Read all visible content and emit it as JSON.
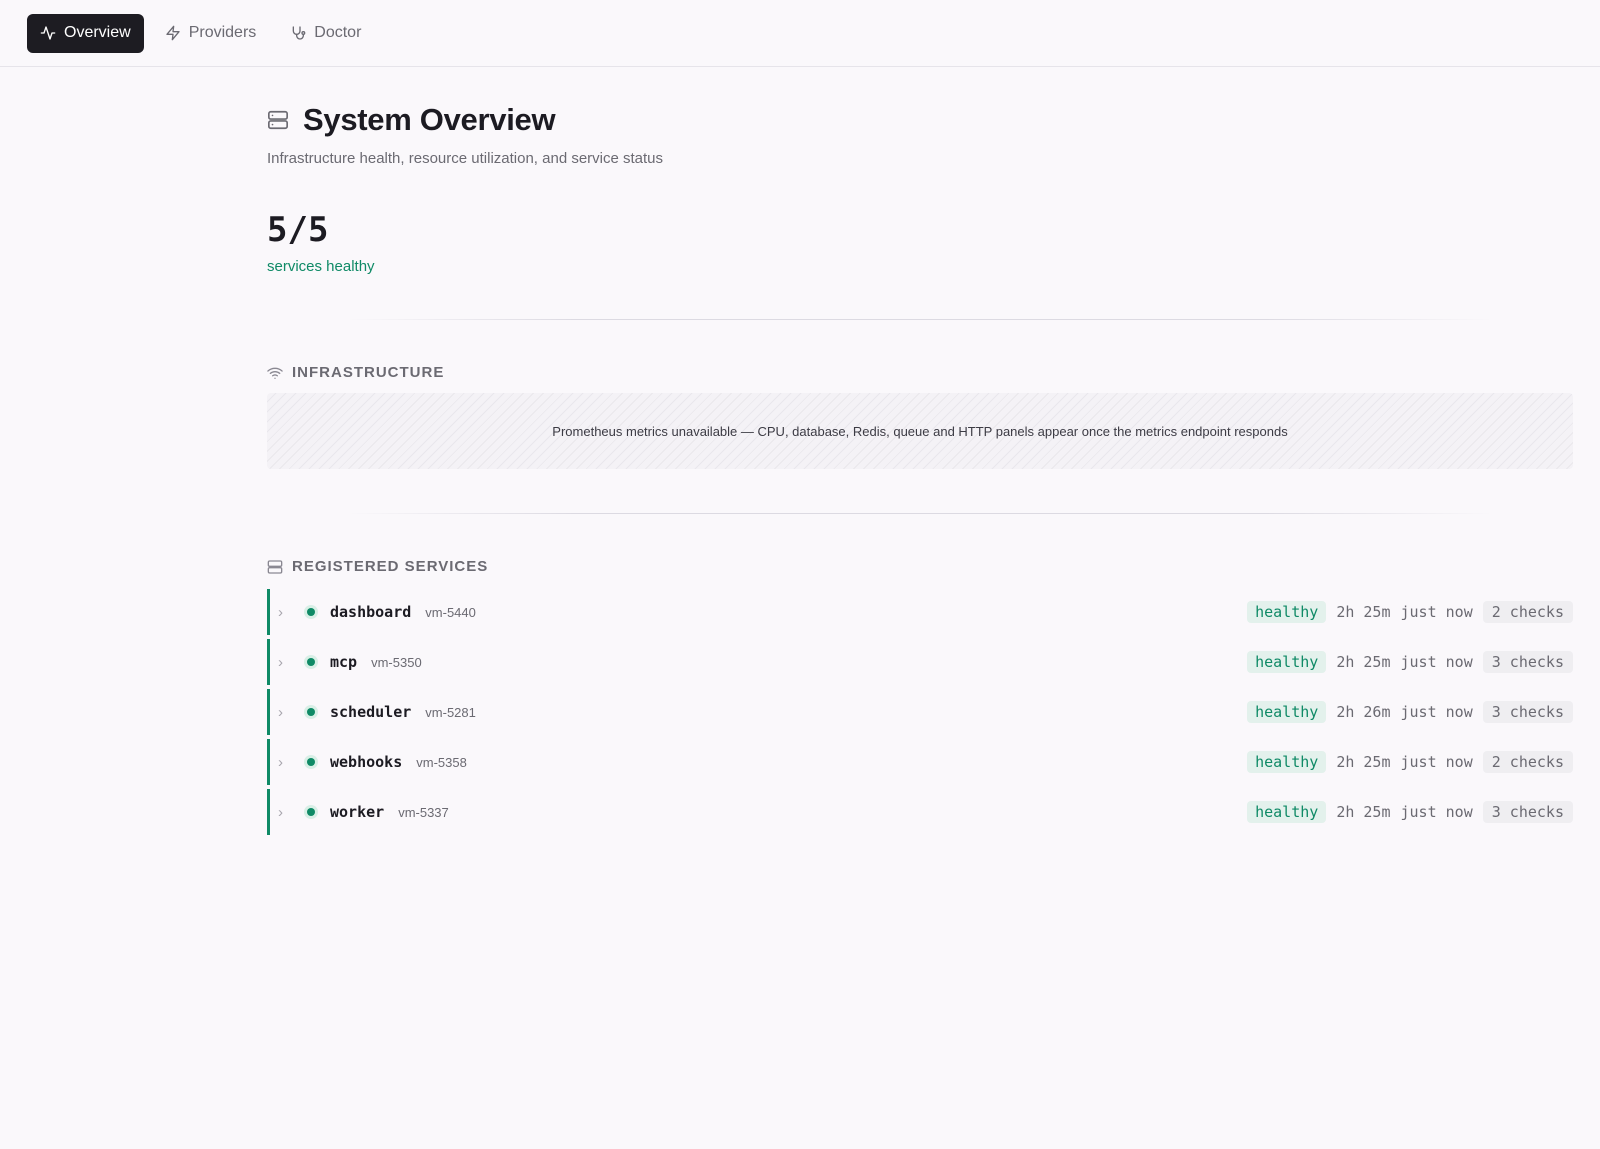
{
  "nav": {
    "tabs": [
      {
        "label": "Overview",
        "icon": "activity-icon",
        "active": true
      },
      {
        "label": "Providers",
        "icon": "zap-icon",
        "active": false
      },
      {
        "label": "Doctor",
        "icon": "stethoscope-icon",
        "active": false
      }
    ]
  },
  "header": {
    "title": "System Overview",
    "subtitle": "Infrastructure health, resource utilization, and service status"
  },
  "summary": {
    "count": "5/5",
    "label": "services healthy"
  },
  "infrastructure": {
    "heading": "INFRASTRUCTURE",
    "message": "Prometheus metrics unavailable — CPU, database, Redis, queue and HTTP panels appear once the metrics endpoint responds"
  },
  "services": {
    "heading": "REGISTERED SERVICES",
    "items": [
      {
        "name": "dashboard",
        "host": "vm-5440",
        "status": "healthy",
        "uptime": "2h 25m",
        "last_seen": "just now",
        "checks": "2 checks"
      },
      {
        "name": "mcp",
        "host": "vm-5350",
        "status": "healthy",
        "uptime": "2h 25m",
        "last_seen": "just now",
        "checks": "3 checks"
      },
      {
        "name": "scheduler",
        "host": "vm-5281",
        "status": "healthy",
        "uptime": "2h 26m",
        "last_seen": "just now",
        "checks": "3 checks"
      },
      {
        "name": "webhooks",
        "host": "vm-5358",
        "status": "healthy",
        "uptime": "2h 25m",
        "last_seen": "just now",
        "checks": "2 checks"
      },
      {
        "name": "worker",
        "host": "vm-5337",
        "status": "healthy",
        "uptime": "2h 25m",
        "last_seen": "just now",
        "checks": "3 checks"
      }
    ]
  },
  "colors": {
    "accent_green": "#0f8a66",
    "nav_active_bg": "#1d1c22"
  }
}
